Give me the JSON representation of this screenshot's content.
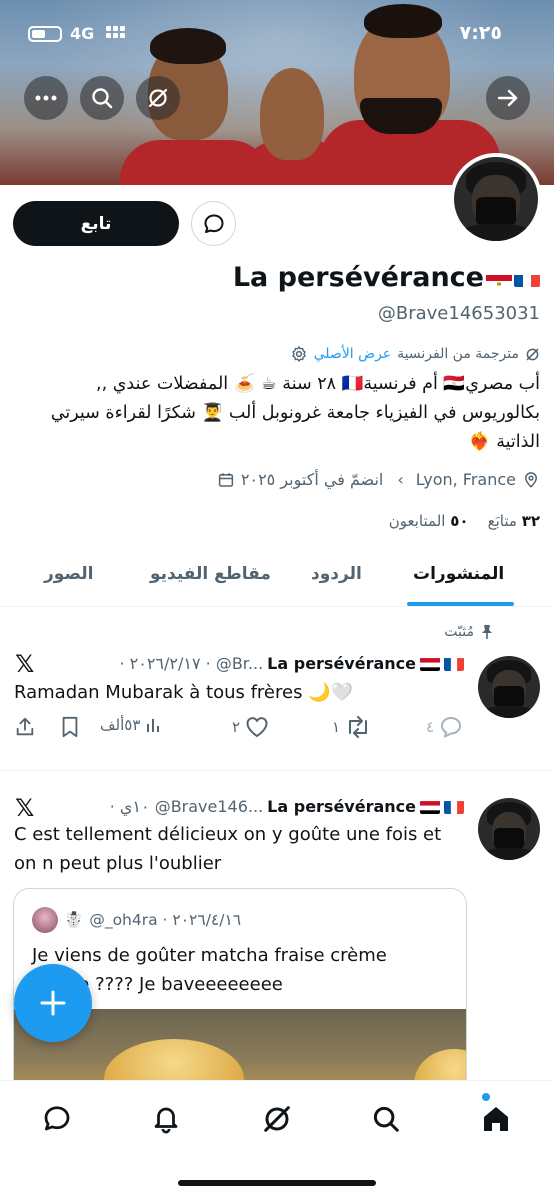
{
  "status_bar": {
    "time": "٧:٢٥",
    "network": "4G"
  },
  "profile": {
    "follow_label": "تابع",
    "display_name": "La persévérance",
    "handle": "@Brave14653031",
    "translated_from": "مترجمة من الفرنسية",
    "show_original": "عرض الأصلي",
    "bio_line1": "أب مصري🇪🇬 أم فرنسية🇫🇷 ٢٨ سنة ☕ 🍝 المفضلات عندي ,,",
    "bio_line2": "بكالوريوس في الفيزياء جامعة غرونوبل ألب 👨‍🎓 شكرًا لقراءة سيرتي",
    "bio_line3": "الذاتية ❤️‍🔥",
    "location": "Lyon, France",
    "joined": "انضمّ في أكتوبر ٢٠٢٥",
    "following_count": "٣٢",
    "following_label": "متابَع",
    "followers_count": "٥٠",
    "followers_label": "المتابعون"
  },
  "tabs": [
    "المنشورات",
    "الردود",
    "مقاطع الفيديو",
    "الصور"
  ],
  "pinned_label": "مُثبّت",
  "posts": [
    {
      "name": "La persévérance",
      "handle_date": "· ٢٠٢٦/٢/١٧ · @Br...",
      "text": "Ramadan Mubarak à tous frères 🌙🤍",
      "replies": "٤",
      "retweets": "١",
      "likes": "٢",
      "views": "٥٣ألف"
    },
    {
      "name": "La persévérance",
      "handle_date": "· ١٠ي @Brave146...",
      "text_line1": "C est tellement délicieux on y goûte une fois et",
      "text_line2": "on n peut plus l'oublier",
      "quote": {
        "handle_date": "@_oh4ra · ٢٠٢٦/٤/١٦",
        "emoji": "☃️",
        "text_line1": "Je viens de goûter matcha fraise crème",
        "text_line2": "brûlée ???? Je baveeeeeeee"
      }
    }
  ],
  "icons": {
    "more": "more-icon",
    "search": "search-icon",
    "grok": "grok-icon",
    "forward": "arrow-right-icon",
    "message": "message-icon",
    "settings": "gear-icon",
    "calendar": "calendar-icon",
    "location": "location-pin-icon",
    "pin": "pin-icon",
    "x_logo": "x-logo-icon"
  },
  "colors": {
    "accent": "#1d9bf0",
    "text": "#0f1419",
    "muted": "#536471"
  }
}
